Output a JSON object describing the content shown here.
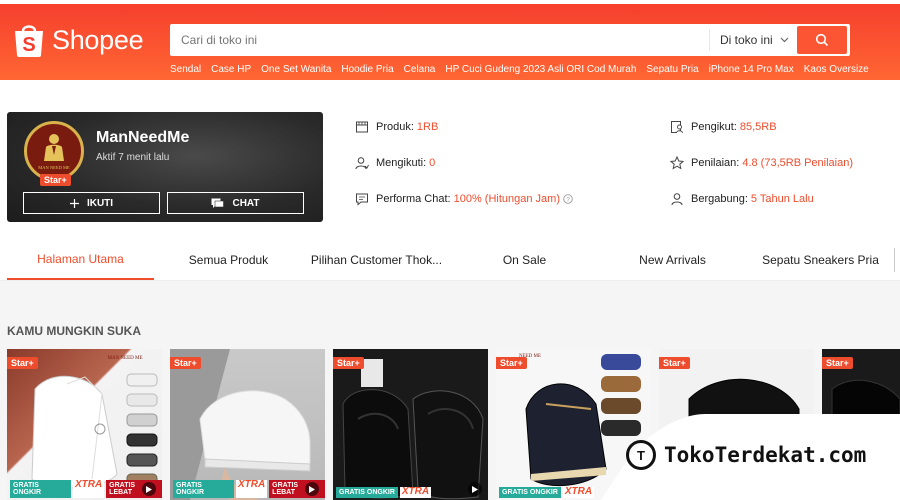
{
  "header": {
    "logo_text": "Shopee",
    "search_placeholder": "Cari di toko ini",
    "search_scope": "Di toko ini",
    "suggestions": [
      "Sendal",
      "Case HP",
      "One Set Wanita",
      "Hoodie Pria",
      "Celana",
      "HP Cuci Gudeng 2023 Asli ORI Cod Murah",
      "Sepatu Pria",
      "iPhone 14 Pro Max",
      "Kaos Oversize"
    ]
  },
  "shop": {
    "name": "ManNeedMe",
    "active": "Aktif 7 menit lalu",
    "badge": "Star+",
    "avatar_text": "MAN NEED ME",
    "follow_label": "IKUTI",
    "chat_label": "CHAT"
  },
  "stats": {
    "produk_label": "Produk:",
    "produk_value": "1RB",
    "mengikuti_label": "Mengikuti:",
    "mengikuti_value": "0",
    "chat_label": "Performa Chat:",
    "chat_value": "100% (Hitungan Jam)",
    "pengikut_label": "Pengikut:",
    "pengikut_value": "85,5RB",
    "penilaian_label": "Penilaian:",
    "penilaian_value": "4.8 (73,5RB Penilaian)",
    "bergabung_label": "Bergabung:",
    "bergabung_value": "5 Tahun Lalu"
  },
  "tabs": [
    "Halaman Utama",
    "Semua Produk",
    "Pilihan Customer Thok...",
    "On Sale",
    "New Arrivals",
    "Sepatu Sneakers Pria"
  ],
  "section_title": "KAMU MUNGKIN SUKA",
  "products": [
    {
      "badge": "Star+",
      "promo_free": "GRATIS ONGKIR",
      "promo_xtra": "XTRA",
      "promo_cod": "GRATIS LEBAT",
      "brand": "MAN NEED ME"
    },
    {
      "badge": "Star+",
      "promo_free": "GRATIS ONGKIR",
      "promo_xtra": "XTRA",
      "promo_cod": "GRATIS LEBAT"
    },
    {
      "badge": "Star+",
      "promo_free": "GRATIS ONGKIR",
      "promo_xtra": "XTRA"
    },
    {
      "badge": "Star+",
      "promo_free": "GRATIS ONGKIR",
      "promo_xtra": "XTRA",
      "brand": "NEED ME"
    },
    {
      "badge": "Star+"
    },
    {
      "badge": "Star+"
    }
  ],
  "watermark": {
    "logo_letter": "T",
    "text": "TokoTerdekat.com"
  },
  "colors": {
    "brand": "#ee4d2d",
    "header_top": "#f53d2d",
    "header_bottom": "#ff6633"
  }
}
